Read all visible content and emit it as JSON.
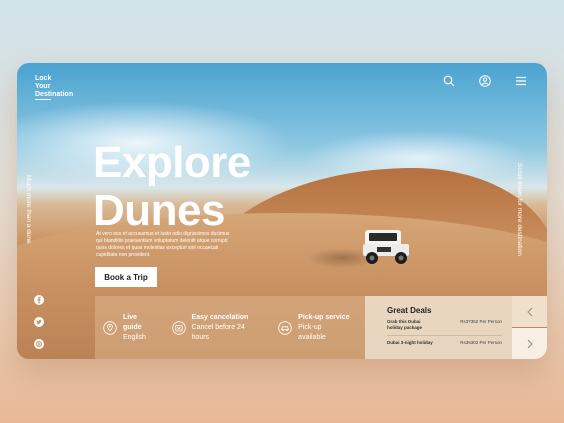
{
  "brand": {
    "line1": "Lock",
    "line2": "Your",
    "line3": "Destination"
  },
  "header_icons": [
    "search-icon",
    "user-icon",
    "menu-icon"
  ],
  "hero": {
    "title_line1": "Explore",
    "title_line2": "Dunes",
    "description": "At vero eos et accusamus et iusto odio dignissimos ducimus qui blanditiis praesentium voluptatum deleniti atque corrupti quos dolores et quas molestias excepturi sint occaecati cupiditate non provident.",
    "cta_label": "Book a Trip"
  },
  "side_left_text": "Much more than a dune",
  "side_right_text": "Scroll down for more destination",
  "social": [
    "facebook-icon",
    "twitter-icon",
    "instagram-icon"
  ],
  "features": [
    {
      "icon": "location-icon",
      "title": "Live guide",
      "subtitle": "English"
    },
    {
      "icon": "cancel-icon",
      "title": "Easy cancelation",
      "subtitle": "Cancel before 24 hours"
    },
    {
      "icon": "pickup-icon",
      "title": "Pick-up service",
      "subtitle": "Pick-up available"
    }
  ],
  "deals": {
    "heading": "Great Deals",
    "items": [
      {
        "name": "Grab this Dubai holiday package",
        "price": "Rs37352 Per Person"
      },
      {
        "name": "Dubai 3-night holiday",
        "price": "Rs36302 Per Person"
      }
    ]
  },
  "colors": {
    "accent": "#ffffff",
    "panel": "#ecdcc8",
    "sand": "#c99162",
    "sky": "#4aa3d0"
  }
}
